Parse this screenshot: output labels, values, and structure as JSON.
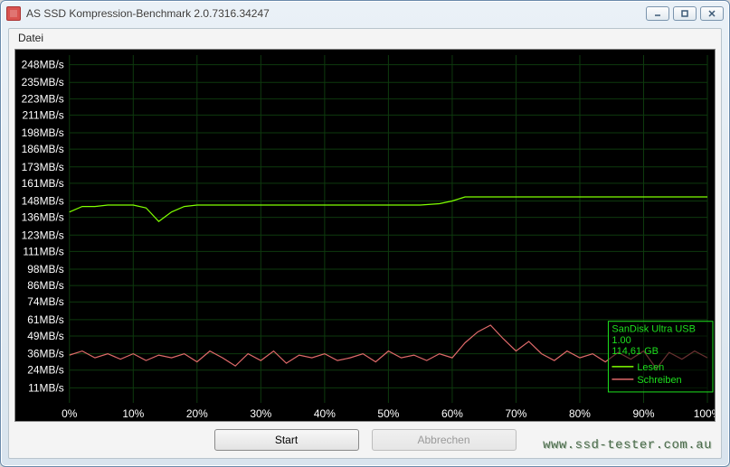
{
  "window": {
    "title": "AS SSD Kompression-Benchmark 2.0.7316.34247"
  },
  "menu": {
    "file": "Datei"
  },
  "buttons": {
    "start": "Start",
    "cancel": "Abbrechen"
  },
  "info": {
    "device": "SanDisk Ultra USB",
    "firmware": "1.00",
    "capacity": "114,61 GB",
    "legend_read": "Lesen",
    "legend_write": "Schreiben"
  },
  "watermark": "www.ssd-tester.com.au",
  "chart_data": {
    "type": "line",
    "xlabel": "",
    "ylabel": "",
    "x_ticks": [
      "0%",
      "10%",
      "20%",
      "30%",
      "40%",
      "50%",
      "60%",
      "70%",
      "80%",
      "90%",
      "100%"
    ],
    "y_ticks": [
      "11MB/s",
      "24MB/s",
      "36MB/s",
      "49MB/s",
      "61MB/s",
      "74MB/s",
      "86MB/s",
      "98MB/s",
      "111MB/s",
      "123MB/s",
      "136MB/s",
      "148MB/s",
      "161MB/s",
      "173MB/s",
      "186MB/s",
      "198MB/s",
      "211MB/s",
      "223MB/s",
      "235MB/s",
      "248MB/s"
    ],
    "x_range": [
      0,
      100
    ],
    "y_range": [
      0,
      255
    ],
    "series": [
      {
        "name": "Lesen",
        "color": "#7fff00",
        "x": [
          0,
          2,
          4,
          6,
          8,
          10,
          12,
          14,
          16,
          18,
          20,
          25,
          30,
          35,
          40,
          45,
          50,
          55,
          58,
          60,
          62,
          65,
          70,
          75,
          80,
          85,
          90,
          95,
          100
        ],
        "y": [
          140,
          144,
          144,
          145,
          145,
          145,
          143,
          133,
          140,
          144,
          145,
          145,
          145,
          145,
          145,
          145,
          145,
          145,
          146,
          148,
          151,
          151,
          151,
          151,
          151,
          151,
          151,
          151,
          151
        ]
      },
      {
        "name": "Schreiben",
        "color": "#e06a6a",
        "x": [
          0,
          2,
          4,
          6,
          8,
          10,
          12,
          14,
          16,
          18,
          20,
          22,
          24,
          26,
          28,
          30,
          32,
          34,
          36,
          38,
          40,
          42,
          44,
          46,
          48,
          50,
          52,
          54,
          56,
          58,
          60,
          62,
          64,
          66,
          68,
          70,
          72,
          74,
          76,
          78,
          80,
          82,
          84,
          86,
          88,
          90,
          92,
          94,
          96,
          98,
          100
        ],
        "y": [
          35,
          38,
          33,
          36,
          32,
          36,
          31,
          35,
          33,
          36,
          30,
          38,
          33,
          27,
          36,
          31,
          38,
          29,
          35,
          33,
          36,
          31,
          33,
          36,
          30,
          38,
          33,
          35,
          31,
          36,
          33,
          44,
          52,
          57,
          47,
          38,
          45,
          36,
          31,
          38,
          33,
          36,
          30,
          37,
          32,
          38,
          25,
          37,
          32,
          38,
          33
        ]
      }
    ]
  }
}
